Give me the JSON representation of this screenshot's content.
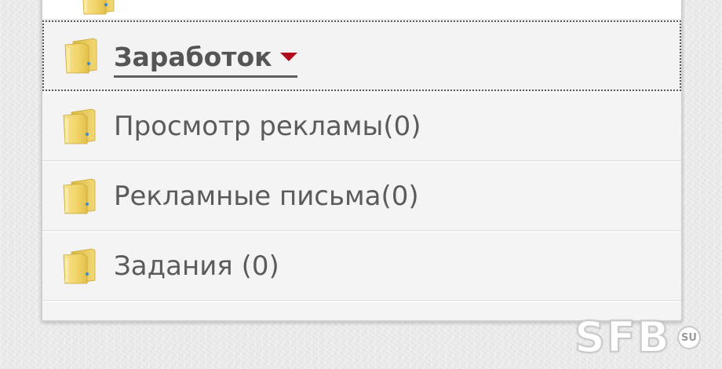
{
  "menu": {
    "active_item": {
      "label": "Заработок",
      "icon": "folder-icon",
      "dropdown_icon": "caret-down-icon",
      "dropdown_color": "#b10c1e"
    },
    "items": [
      {
        "label": "Просмотр рекламы(0)",
        "icon": "folder-icon"
      },
      {
        "label": "Рекламные письма(0)",
        "icon": "folder-icon"
      },
      {
        "label": "Задания (0)",
        "icon": "folder-icon"
      }
    ]
  },
  "watermark": {
    "text": "SFB",
    "suffix": "SU"
  }
}
